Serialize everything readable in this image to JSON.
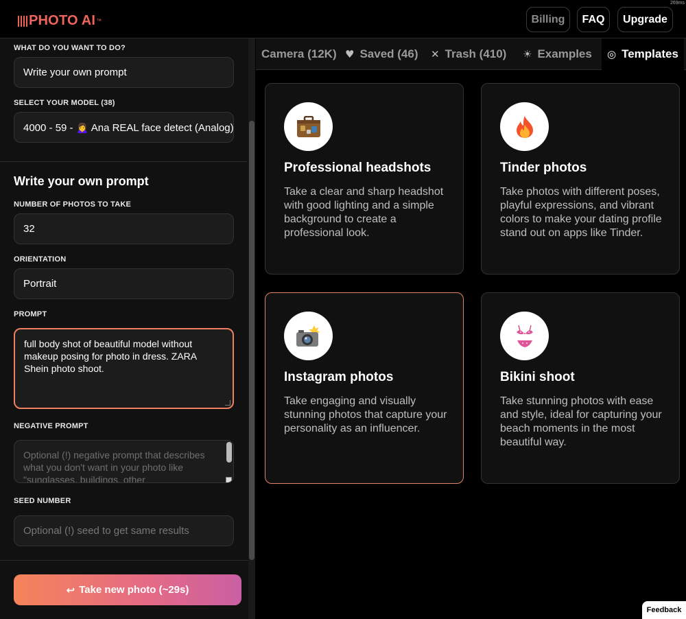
{
  "app": {
    "logo_text": "PHOTO AI",
    "logo_tm": "™",
    "corner_label": "269ms"
  },
  "header": {
    "billing_label": "Billing",
    "faq_label": "FAQ",
    "upgrade_label": "Upgrade"
  },
  "form": {
    "what_label": "WHAT DO YOU WANT TO DO?",
    "what_value": "Write your own prompt",
    "model_label": "SELECT YOUR MODEL (38)",
    "model_value": "4000 - 59 - 🙍‍♀️ Ana REAL face detect (Analog)",
    "section_title": "Write your own prompt",
    "photos_label": "NUMBER OF PHOTOS TO TAKE",
    "photos_value": "32",
    "orientation_label": "ORIENTATION",
    "orientation_value": "Portrait",
    "prompt_label": "PROMPT",
    "prompt_value": "full body shot of beautiful model without makeup posing for photo in dress. ZARA Shein photo shoot.",
    "negative_label": "NEGATIVE PROMPT",
    "negative_placeholder": "Optional (!) negative prompt that describes what you don't want in your photo like \"sunglasses, buildings, other",
    "seed_label": "SEED NUMBER",
    "seed_placeholder": "Optional (!) seed to get same results",
    "take_photo_label": "Take new photo (~29s)",
    "take_photo_icon": "↩"
  },
  "tabs": [
    {
      "label": "Camera (12K)",
      "icon": "",
      "icon_name": ""
    },
    {
      "label": "Saved (46)",
      "icon": "♥",
      "icon_name": "heart-icon"
    },
    {
      "label": "Trash (410)",
      "icon": "✕",
      "icon_name": "close-icon"
    },
    {
      "label": "Examples",
      "icon": "☀",
      "icon_name": "sparkle-icon"
    },
    {
      "label": "Templates",
      "icon": "◎",
      "icon_name": "aperture-icon"
    }
  ],
  "templates": [
    {
      "emoji": "💼",
      "icon_name": "briefcase-icon",
      "title": "Professional headshots",
      "description": "Take a clear and sharp headshot with good lighting and a simple background to create a professional look."
    },
    {
      "emoji": "🔥",
      "icon_name": "fire-icon",
      "title": "Tinder photos",
      "description": "Take photos with different poses, playful expressions, and vibrant colors to make your dating profile stand out on apps like Tinder."
    },
    {
      "emoji": "📸",
      "icon_name": "camera-flash-icon",
      "title": "Instagram photos",
      "description": "Take engaging and visually stunning photos that capture your personality as an influencer."
    },
    {
      "emoji": "👙",
      "icon_name": "bikini-icon",
      "title": "Bikini shoot",
      "description": "Take stunning photos with ease and style, ideal for capturing your beach moments in the most beautiful way."
    }
  ],
  "feedback_label": "Feedback",
  "colors": {
    "accent": "#f0645c",
    "selected_border": "#e48563",
    "gradient_start": "#f5845a",
    "gradient_end": "#c960a3"
  }
}
